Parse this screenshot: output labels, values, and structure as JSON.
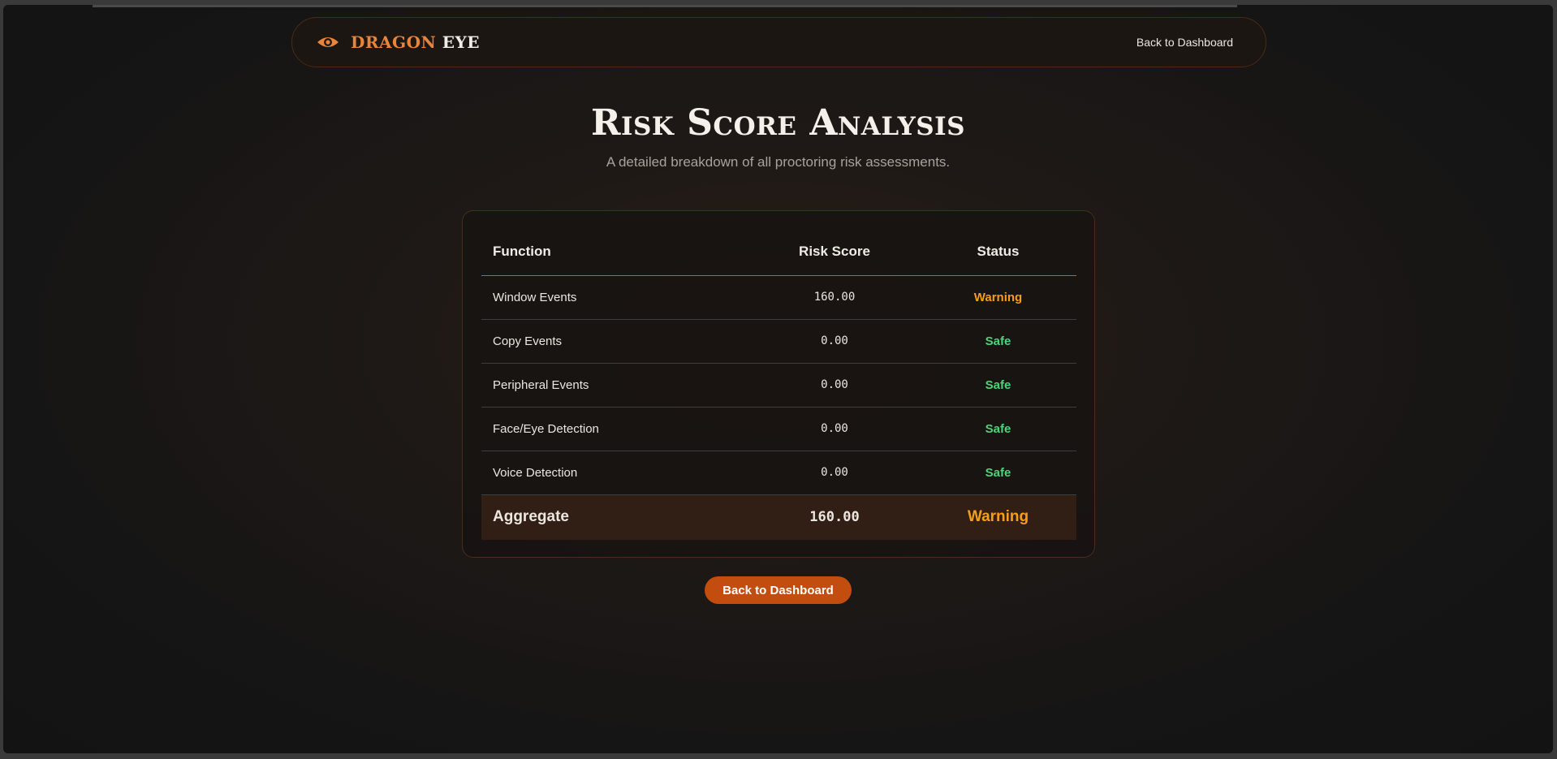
{
  "navbar": {
    "brand_part1": "DRAGON",
    "brand_part2": "EYE",
    "back_link": "Back to Dashboard",
    "icon": "eye-icon"
  },
  "page": {
    "title": "Risk Score Analysis",
    "subtitle": "A detailed breakdown of all proctoring risk assessments."
  },
  "table": {
    "headers": [
      "Function",
      "Risk Score",
      "Status"
    ],
    "rows": [
      {
        "function": "Window Events",
        "score": "160.00",
        "status": "Warning"
      },
      {
        "function": "Copy Events",
        "score": "0.00",
        "status": "Safe"
      },
      {
        "function": "Peripheral Events",
        "score": "0.00",
        "status": "Safe"
      },
      {
        "function": "Face/Eye Detection",
        "score": "0.00",
        "status": "Safe"
      },
      {
        "function": "Voice Detection",
        "score": "0.00",
        "status": "Safe"
      }
    ],
    "aggregate": {
      "function": "Aggregate",
      "score": "160.00",
      "status": "Warning"
    }
  },
  "footer_button": "Back to Dashboard",
  "colors": {
    "accent": "#e8853a",
    "button": "#c24d0e",
    "warning": "#f59e1a",
    "safe": "#4ed27a"
  }
}
